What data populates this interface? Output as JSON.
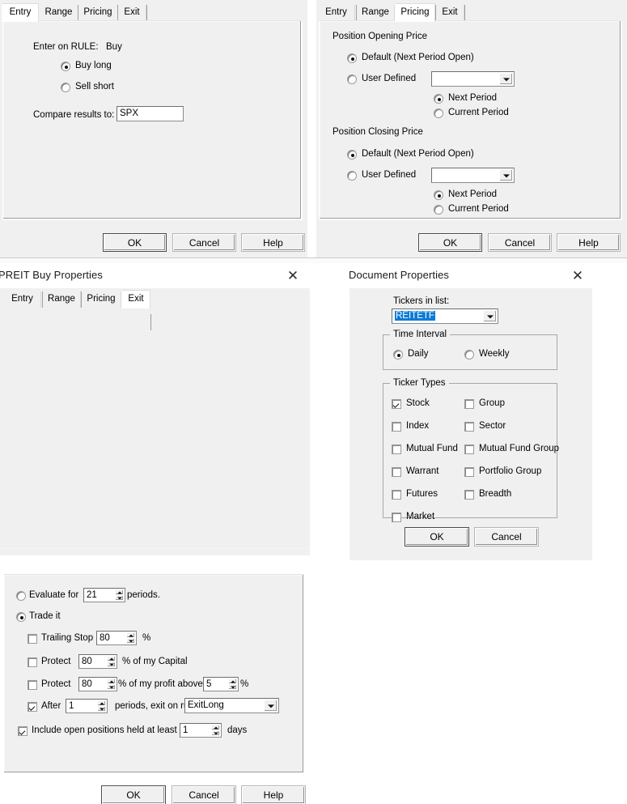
{
  "panels": {
    "entry": {
      "tabs": [
        {
          "label": "Entry",
          "active": true
        },
        {
          "label": "Range",
          "active": false
        },
        {
          "label": "Pricing",
          "active": false
        },
        {
          "label": "Exit",
          "active": false
        }
      ],
      "rule_label": "Enter on RULE:",
      "rule_value": "Buy",
      "radio_buy_long": "Buy long",
      "radio_sell_short": "Sell short",
      "compare_label": "Compare results to:",
      "compare_value": "SPX",
      "buttons": {
        "ok": "OK",
        "cancel": "Cancel",
        "help": "Help"
      }
    },
    "pricing": {
      "tabs": [
        {
          "label": "Entry",
          "active": false
        },
        {
          "label": "Range",
          "active": false
        },
        {
          "label": "Pricing",
          "active": true
        },
        {
          "label": "Exit",
          "active": false
        }
      ],
      "opening_group": "Position Opening Price",
      "opening_default": "Default (Next Period Open)",
      "opening_user": "User Defined",
      "opening_combo_value": "",
      "opening_next": "Next Period",
      "opening_current": "Current Period",
      "closing_group": "Position Closing Price",
      "closing_default": "Default (Next Period Open)",
      "closing_user": "User Defined",
      "closing_combo_value": "",
      "closing_next": "Next Period",
      "closing_current": "Current Period",
      "buttons": {
        "ok": "OK",
        "cancel": "Cancel",
        "help": "Help"
      }
    },
    "exit": {
      "title": "PREIT Buy Properties",
      "close_icon": "close-icon",
      "tabs": [
        {
          "label": "Entry",
          "active": false
        },
        {
          "label": "Range",
          "active": false
        },
        {
          "label": "Pricing",
          "active": false
        },
        {
          "label": "Exit",
          "active": true
        }
      ],
      "evaluate_pre": "Evaluate for",
      "evaluate_value": "21",
      "evaluate_post": "periods.",
      "trade_it": "Trade it",
      "trailing_stop_label": "Trailing Stop",
      "trailing_stop_value": "80",
      "trailing_stop_unit": "%",
      "protect_capital_label": "Protect",
      "protect_capital_value": "80",
      "protect_capital_post": "% of my Capital",
      "protect_profit_label": "Protect",
      "protect_profit_value": "80",
      "protect_profit_mid": "% of my profit above",
      "protect_profit_above": "5",
      "protect_profit_unit": "%",
      "after_label": "After",
      "after_value": "1",
      "after_mid": "periods, exit on rule",
      "after_rule": "ExitLong",
      "include_label": "Include open positions held at least",
      "include_value": "1",
      "include_unit": "days",
      "buttons": {
        "ok": "OK",
        "cancel": "Cancel",
        "help": "Help"
      }
    },
    "document": {
      "title": "Document Properties",
      "close_icon": "close-icon",
      "tickers_label": "Tickers in list:",
      "tickers_value": "REITETF",
      "time_interval_group": "Time Interval",
      "interval_daily": "Daily",
      "interval_weekly": "Weekly",
      "ticker_types_group": "Ticker Types",
      "types_left": [
        {
          "label": "Stock",
          "checked": true
        },
        {
          "label": "Index",
          "checked": false
        },
        {
          "label": "Mutual Fund",
          "checked": false
        },
        {
          "label": "Warrant",
          "checked": false
        },
        {
          "label": "Futures",
          "checked": false
        },
        {
          "label": "Market",
          "checked": false
        }
      ],
      "types_right": [
        {
          "label": "Group",
          "checked": false
        },
        {
          "label": "Sector",
          "checked": false
        },
        {
          "label": "Mutual Fund Group",
          "checked": false
        },
        {
          "label": "Portfolio Group",
          "checked": false
        },
        {
          "label": "Breadth",
          "checked": false
        }
      ],
      "buttons": {
        "ok": "OK",
        "cancel": "Cancel"
      }
    }
  },
  "colors": {
    "dialog_face": "#f0f0f0",
    "selection_blue": "#0a7bd6",
    "border_gray": "#8c8c8c"
  }
}
